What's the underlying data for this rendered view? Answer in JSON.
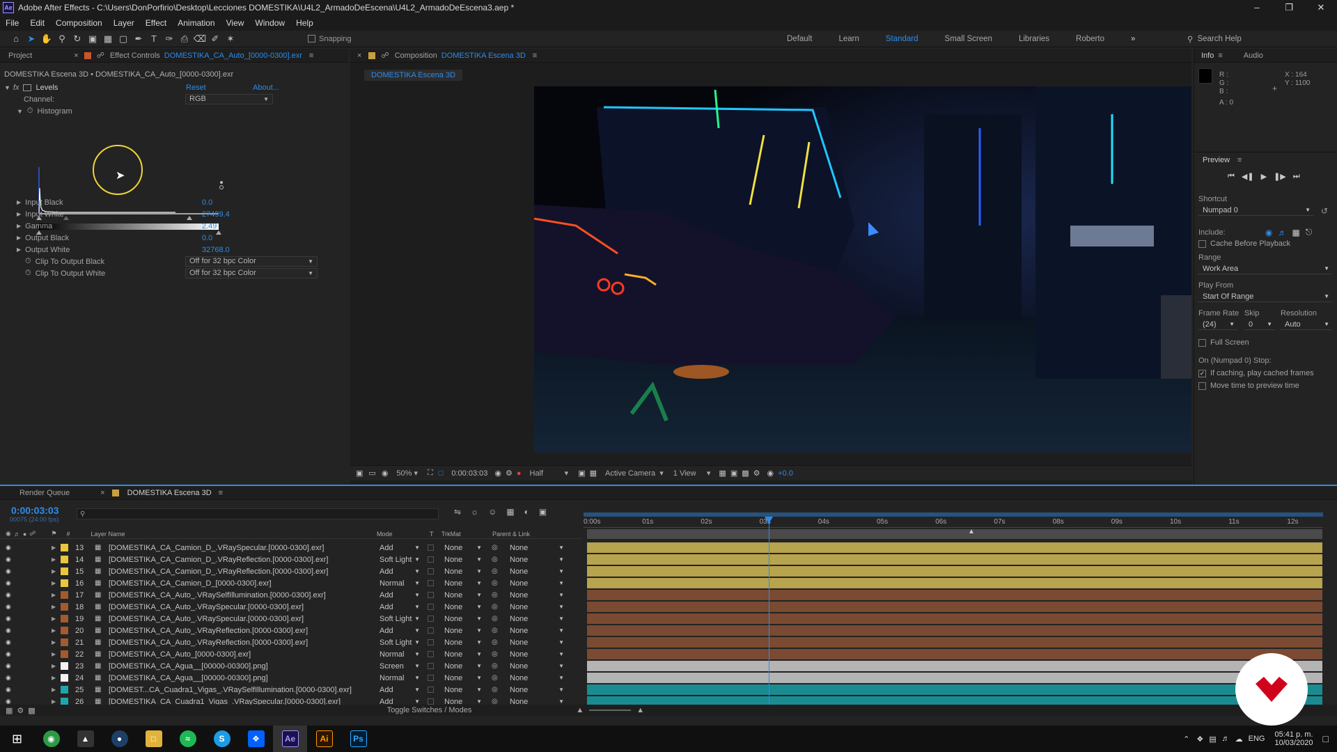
{
  "window": {
    "app_icon": "Ae",
    "title": "Adobe After Effects - C:\\Users\\DonPorfirio\\Desktop\\Lecciones DOMESTIKA\\U4L2_ArmadoDeEscena\\U4L2_ArmadoDeEscena3.aep *"
  },
  "menu": [
    "File",
    "Edit",
    "Composition",
    "Layer",
    "Effect",
    "Animation",
    "View",
    "Window",
    "Help"
  ],
  "toolbar": {
    "snapping_label": "Snapping",
    "workspaces": [
      "Default",
      "Learn",
      "Standard",
      "Small Screen",
      "Libraries",
      "Roberto"
    ],
    "active_workspace": "Standard",
    "search_placeholder": "Search Help"
  },
  "effect_panel": {
    "tab_project": "Project",
    "tab_effect_prefix": "Effect Controls",
    "tab_effect_file": "DOMESTIKA_CA_Auto_[0000-0300].exr",
    "header": "DOMESTIKA Escena 3D • DOMESTIKA_CA_Auto_[0000-0300].exr",
    "fx_label": "fx",
    "effect_name": "Levels",
    "reset": "Reset",
    "about": "About...",
    "channel_label": "Channel:",
    "channel_value": "RGB",
    "histogram_label": "Histogram",
    "params": [
      {
        "name": "Input Black",
        "value": "0.0"
      },
      {
        "name": "Input White",
        "value": "27499.4"
      },
      {
        "name": "Gamma",
        "value": "2.49"
      },
      {
        "name": "Output Black",
        "value": "0.0"
      },
      {
        "name": "Output White",
        "value": "32768.0"
      }
    ],
    "clip_black_label": "Clip To Output Black",
    "clip_black_value": "Off for 32 bpc Color",
    "clip_white_label": "Clip To Output White",
    "clip_white_value": "Off for 32 bpc Color"
  },
  "composition": {
    "tab_prefix": "Composition",
    "tab_name": "DOMESTIKA Escena 3D",
    "sub_tab": "DOMESTIKA Escena 3D",
    "zoom": "50%",
    "timecode": "0:00:03:03",
    "resolution": "Half",
    "camera": "Active Camera",
    "views": "1 View",
    "exposure": "+0.0"
  },
  "info_panel": {
    "tab_info": "Info",
    "tab_audio": "Audio",
    "r": "R :",
    "g": "G :",
    "b": "B :",
    "a": "A : 0",
    "x": "X : 164",
    "y": "Y : 1100"
  },
  "preview_panel": {
    "title": "Preview",
    "shortcut_label": "Shortcut",
    "shortcut_value": "Numpad 0",
    "include_label": "Include:",
    "cache_label": "Cache Before Playback",
    "range_label": "Range",
    "range_value": "Work Area",
    "play_from_label": "Play From",
    "play_from_value": "Start Of Range",
    "frame_rate_label": "Frame Rate",
    "skip_label": "Skip",
    "resolution_label": "Resolution",
    "frame_rate_value": "(24)",
    "skip_value": "0",
    "resolution_value": "Auto",
    "full_screen_label": "Full Screen",
    "stop_label": "On (Numpad 0) Stop:",
    "if_caching_label": "If caching, play cached frames",
    "move_time_label": "Move time to preview time"
  },
  "timeline": {
    "tab_render": "Render Queue",
    "tab_comp": "DOMESTIKA Escena 3D",
    "timecode": "0:00:03:03",
    "frames": "00075 (24.00 fps)",
    "search_placeholder": "",
    "col_num": "#",
    "col_layer": "Layer Name",
    "col_mode": "Mode",
    "col_t": "T",
    "col_trkmat": "TrkMat",
    "col_parent": "Parent & Link",
    "ruler": [
      "0:00s",
      "01s",
      "02s",
      "03s",
      "04s",
      "05s",
      "06s",
      "07s",
      "08s",
      "09s",
      "10s",
      "11s",
      "12s"
    ],
    "toggle_label": "Toggle Switches / Modes",
    "layers": [
      {
        "num": "13",
        "name": "[DOMESTIKA_CA_Camion_D_.VRaySpecular.[0000-0300].exr]",
        "mode": "Add",
        "trkmat": "None",
        "parent": "None",
        "color": "#e8c73c",
        "bar": "#b8a34e"
      },
      {
        "num": "14",
        "name": "[DOMESTIKA_CA_Camion_D_.VRayReflection.[0000-0300].exr]",
        "mode": "Soft Light",
        "trkmat": "None",
        "parent": "None",
        "color": "#e8c73c",
        "bar": "#b8a34e"
      },
      {
        "num": "15",
        "name": "[DOMESTIKA_CA_Camion_D_.VRayReflection.[0000-0300].exr]",
        "mode": "Add",
        "trkmat": "None",
        "parent": "None",
        "color": "#e8c73c",
        "bar": "#b8a34e"
      },
      {
        "num": "16",
        "name": "[DOMESTIKA_CA_Camion_D_[0000-0300].exr]",
        "mode": "Normal",
        "trkmat": "None",
        "parent": "None",
        "color": "#e8c73c",
        "bar": "#b8a34e"
      },
      {
        "num": "17",
        "name": "[DOMESTIKA_CA_Auto_.VRaySelfIllumination.[0000-0300].exr]",
        "mode": "Add",
        "trkmat": "None",
        "parent": "None",
        "color": "#a35a2e",
        "bar": "#7a4a32"
      },
      {
        "num": "18",
        "name": "[DOMESTIKA_CA_Auto_.VRaySpecular.[0000-0300].exr]",
        "mode": "Add",
        "trkmat": "None",
        "parent": "None",
        "color": "#a35a2e",
        "bar": "#7a4a32"
      },
      {
        "num": "19",
        "name": "[DOMESTIKA_CA_Auto_.VRaySpecular.[0000-0300].exr]",
        "mode": "Soft Light",
        "trkmat": "None",
        "parent": "None",
        "color": "#a35a2e",
        "bar": "#7a4a32"
      },
      {
        "num": "20",
        "name": "[DOMESTIKA_CA_Auto_.VRayReflection.[0000-0300].exr]",
        "mode": "Add",
        "trkmat": "None",
        "parent": "None",
        "color": "#a35a2e",
        "bar": "#7a4a32"
      },
      {
        "num": "21",
        "name": "[DOMESTIKA_CA_Auto_.VRayReflection.[0000-0300].exr]",
        "mode": "Soft Light",
        "trkmat": "None",
        "parent": "None",
        "color": "#a35a2e",
        "bar": "#7a4a32"
      },
      {
        "num": "22",
        "name": "[DOMESTIKA_CA_Auto_[0000-0300].exr]",
        "mode": "Normal",
        "trkmat": "None",
        "parent": "None",
        "color": "#a35a2e",
        "bar": "#7a4a32"
      },
      {
        "num": "23",
        "name": "[DOMESTIKA_CA_Agua__[00000-00300].png]",
        "mode": "Screen",
        "trkmat": "None",
        "parent": "None",
        "color": "#f2f2f2",
        "bar": "#b4b4b4"
      },
      {
        "num": "24",
        "name": "[DOMESTIKA_CA_Agua__[00000-00300].png]",
        "mode": "Normal",
        "trkmat": "None",
        "parent": "None",
        "color": "#f2f2f2",
        "bar": "#b4b4b4"
      },
      {
        "num": "25",
        "name": "[DOMEST...CA_Cuadra1_Vigas_.VRaySelfIllumination.[0000-0300].exr]",
        "mode": "Add",
        "trkmat": "None",
        "parent": "None",
        "color": "#1fa6ad",
        "bar": "#1a8b91"
      },
      {
        "num": "26",
        "name": "[DOMESTIKA_CA_Cuadra1_Vigas_.VRaySpecular.[0000-0300].exr]",
        "mode": "Add",
        "trkmat": "None",
        "parent": "None",
        "color": "#1fa6ad",
        "bar": "#1a8b91"
      }
    ]
  },
  "taskbar": {
    "language": "ENG",
    "time": "05:41 p. m.",
    "date": "10/03/2020",
    "apps": [
      "chrome-icon",
      "photos-icon",
      "media-icon",
      "explorer-icon",
      "spotify-icon",
      "skype-icon",
      "dropbox-icon",
      "after-effects-icon",
      "illustrator-icon",
      "photoshop-icon"
    ],
    "app_labels": {
      "ae": "Ae",
      "ai": "Ai",
      "ps": "Ps",
      "skype": "S"
    }
  },
  "colors": {
    "accent": "#2d8ceb",
    "panel": "#232323",
    "brand_watermark": "#d0021b"
  }
}
